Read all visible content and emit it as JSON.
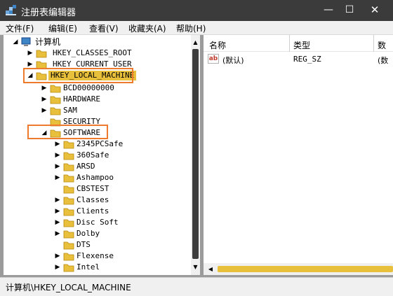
{
  "window": {
    "title": "注册表编辑器",
    "controls": {
      "minimize": "—",
      "maximize": "☐",
      "close": "✕"
    }
  },
  "menu": {
    "items": [
      "文件(F)",
      "编辑(E)",
      "查看(V)",
      "收藏夹(A)",
      "帮助(H)"
    ]
  },
  "tree": {
    "root_label": "计算机",
    "hives": [
      "HKEY_CLASSES_ROOT",
      "HKEY_CURRENT_USER",
      "HKEY_LOCAL_MACHINE"
    ],
    "hklm_children": [
      "BCD00000000",
      "HARDWARE",
      "SAM",
      "SECURITY",
      "SOFTWARE"
    ],
    "software_children": [
      "2345PCSafe",
      "360Safe",
      "ARSD",
      "Ashampoo",
      "CBSTEST",
      "Classes",
      "Clients",
      "Disc Soft",
      "Dolby",
      "DTS",
      "Flexense",
      "Intel"
    ],
    "selected": "HKEY_LOCAL_MACHINE",
    "highlighted": [
      "HKEY_LOCAL_MACHINE",
      "SOFTWARE"
    ]
  },
  "list": {
    "columns": [
      "名称",
      "类型",
      "数"
    ],
    "rows": [
      {
        "name": "(默认)",
        "type": "REG_SZ",
        "data": "(数"
      }
    ]
  },
  "status": {
    "path": "计算机\\HKEY_LOCAL_MACHINE"
  },
  "colors": {
    "selection": "#e8c03c",
    "highlight_box": "#ee7a2d",
    "folder": "#e8c03c"
  },
  "icons": {
    "app": "registry-editor-icon",
    "folder": "folder-icon",
    "value": "string-value-icon",
    "computer": "computer-icon"
  }
}
